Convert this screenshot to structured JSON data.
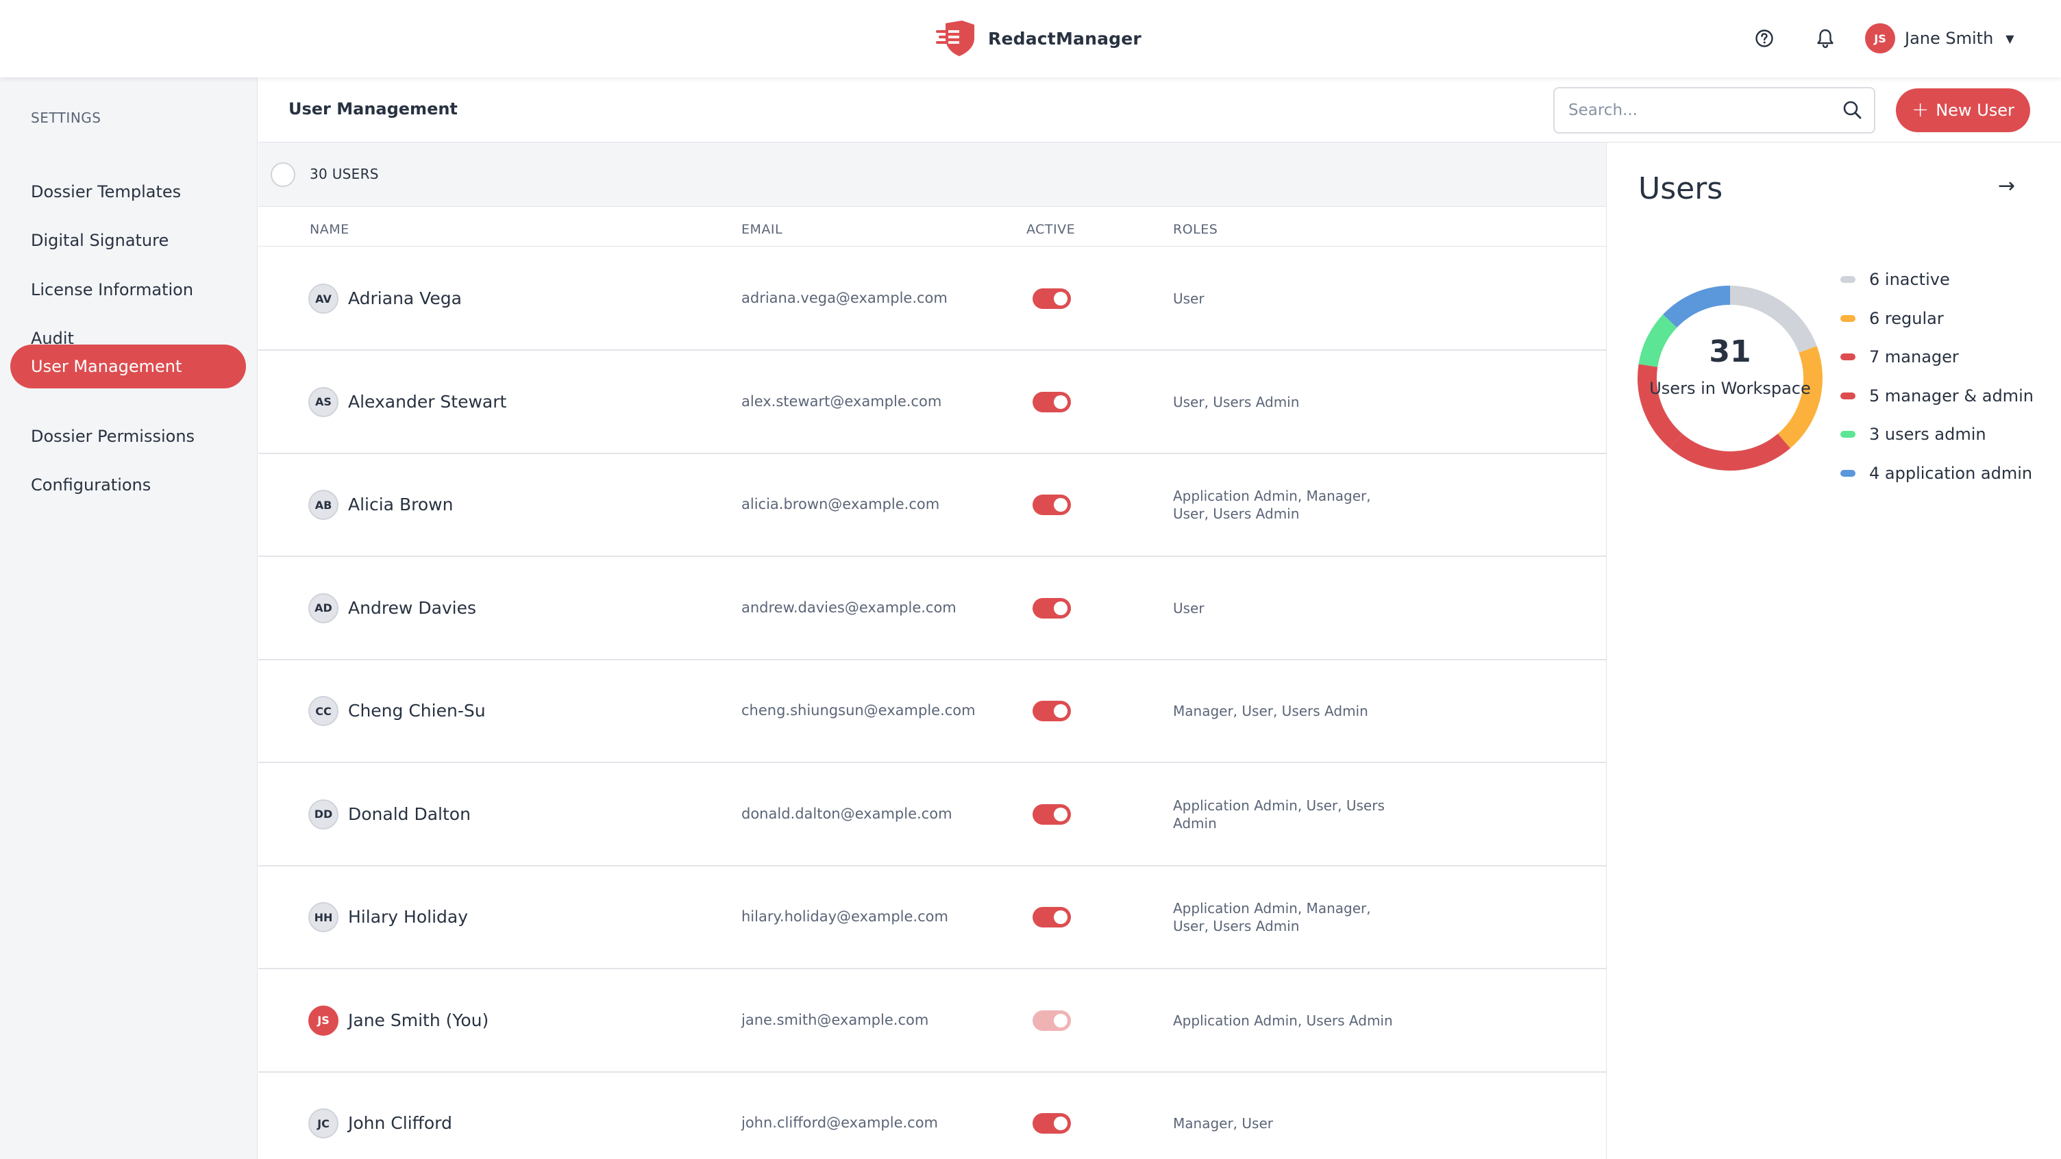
{
  "app": {
    "name": "RedactManager"
  },
  "topbar": {
    "help_icon": "help-circle-icon",
    "notification_icon": "bell-icon",
    "user": {
      "initials": "JS",
      "name": "Jane Smith"
    }
  },
  "sidebar": {
    "header": "SETTINGS",
    "items": [
      {
        "label": "Dossier Templates",
        "active": false
      },
      {
        "label": "Digital Signature",
        "active": false
      },
      {
        "label": "License Information",
        "active": false
      },
      {
        "label": "Audit",
        "active": false
      },
      {
        "label": "User Management",
        "active": true
      },
      {
        "label": "Dossier Permissions",
        "active": false
      },
      {
        "label": "Configurations",
        "active": false
      }
    ]
  },
  "header": {
    "title": "User Management",
    "search_placeholder": "Search...",
    "new_user_label": "New User"
  },
  "table": {
    "count_label": "30 USERS",
    "columns": {
      "name": "NAME",
      "email": "EMAIL",
      "active": "ACTIVE",
      "roles": "ROLES"
    },
    "rows": [
      {
        "initials": "AV",
        "name": "Adriana Vega",
        "email": "adriana.vega@example.com",
        "active": true,
        "roles": "User"
      },
      {
        "initials": "AS",
        "name": "Alexander Stewart",
        "email": "alex.stewart@example.com",
        "active": true,
        "roles": "User, Users Admin"
      },
      {
        "initials": "AB",
        "name": "Alicia Brown",
        "email": "alicia.brown@example.com",
        "active": true,
        "roles": "Application Admin, Manager, User, Users Admin"
      },
      {
        "initials": "AD",
        "name": "Andrew Davies",
        "email": "andrew.davies@example.com",
        "active": true,
        "roles": "User"
      },
      {
        "initials": "CC",
        "name": "Cheng Chien-Su",
        "email": "cheng.shiungsun@example.com",
        "active": true,
        "roles": "Manager, User, Users Admin"
      },
      {
        "initials": "DD",
        "name": "Donald Dalton",
        "email": "donald.dalton@example.com",
        "active": true,
        "roles": "Application Admin, User, Users Admin"
      },
      {
        "initials": "HH",
        "name": "Hilary Holiday",
        "email": "hilary.holiday@example.com",
        "active": true,
        "roles": "Application Admin, Manager, User, Users Admin"
      },
      {
        "initials": "JS",
        "name": "Jane Smith (You)",
        "email": "jane.smith@example.com",
        "active": true,
        "is_me": true,
        "roles": "Application Admin, Users Admin"
      },
      {
        "initials": "JC",
        "name": "John Clifford",
        "email": "john.clifford@example.com",
        "active": true,
        "roles": "Manager, User"
      }
    ]
  },
  "stats": {
    "title": "Users",
    "total": "31",
    "total_label": "Users in Workspace",
    "segments": [
      {
        "label": "6 inactive",
        "value": 6,
        "color": "#d0d3d9"
      },
      {
        "label": "6 regular",
        "value": 6,
        "color": "#fbb13c"
      },
      {
        "label": "7 manager",
        "value": 7,
        "color": "#dd4d50"
      },
      {
        "label": "5 manager & admin",
        "value": 5,
        "color": "#dd4d50"
      },
      {
        "label": "3 users admin",
        "value": 3,
        "color": "#5ce594"
      },
      {
        "label": "4 application admin",
        "value": 4,
        "color": "#5b97db"
      }
    ]
  }
}
